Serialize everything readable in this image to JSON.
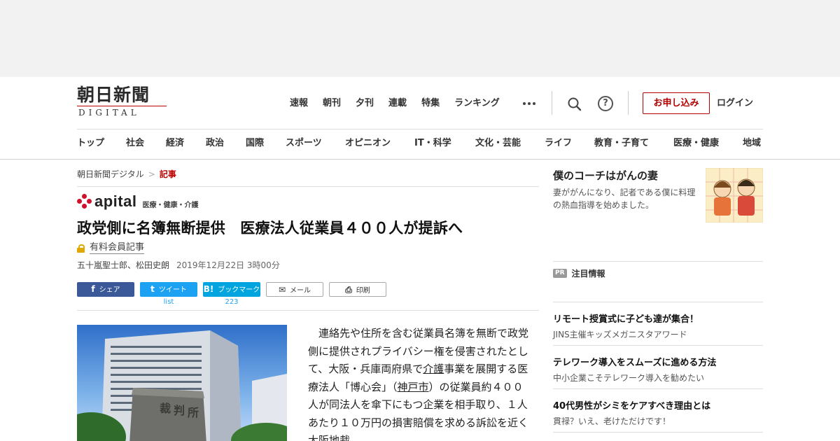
{
  "brand": {
    "logo_main": "朝日新聞",
    "logo_sub": "DIGITAL"
  },
  "top_nav": [
    "速報",
    "朝刊",
    "夕刊",
    "連載",
    "特集",
    "ランキング"
  ],
  "header_actions": {
    "more_icon": "more-dots-icon",
    "search_icon": "search-icon",
    "help_icon": "help-icon",
    "help_glyph": "?",
    "apply_label": "お申し込み",
    "login_label": "ログイン",
    "accent": "#b30000"
  },
  "category_nav": [
    "トップ",
    "社会",
    "経済",
    "政治",
    "国際",
    "スポーツ",
    "オピニオン",
    "IT・科学",
    "文化・芸能",
    "ライフ",
    "教育・子育て",
    "医療・健康",
    "地域"
  ],
  "breadcrumb": {
    "home": "朝日新聞デジタル",
    "separator": ">",
    "current": "記事"
  },
  "section": {
    "brand": "apital",
    "subtitle": "医療・健康・介護"
  },
  "article": {
    "headline": "政党側に名簿無断提供　医療法人従業員４００人が提訴へ",
    "paid_label": "有料会員記事",
    "authors": "五十嵐聖士郎、松田史朗",
    "date": "2019年12月22日 3時00分",
    "body": {
      "p1": "　連絡先や住所を含む従業員名簿を無断で政党側に提供されプライバシー権を侵害されたとして、大阪・兵庫両府県で",
      "link1": "介護",
      "p2": "事業を展開する医療法人「博心会」（",
      "link2": "神戸市",
      "p3": "）の従業員約４００人が同法人を傘下にもつ企業を相手取り、１人あたり１０万円の損害賠償を求める訴訟を近く大阪地裁"
    }
  },
  "share": {
    "facebook": {
      "glyph": "f",
      "label": "シェア"
    },
    "twitter": {
      "glyph": "t",
      "label": "ツイート",
      "count": "list"
    },
    "hatena": {
      "glyph": "B!",
      "label": "ブックマーク",
      "count": "223"
    },
    "mail": {
      "glyph": "✉",
      "label": "メール"
    },
    "print": {
      "glyph": "⎙",
      "label": "印刷"
    },
    "colors": {
      "facebook": "#3b5998",
      "twitter": "#1da1f2",
      "hatena": "#00a4de"
    }
  },
  "sidebar": {
    "feature": {
      "title": "僕のコーチはがんの妻",
      "description": "妻ががんになり、記者である僕に料理の熱血指導を始めました。"
    },
    "pr": {
      "badge": "PR",
      "heading": "注目情報",
      "items": [
        {
          "title": "リモート授賞式に子ども達が集合！",
          "subtitle": "JINS主催キッズメガニスタアワード"
        },
        {
          "title": "テレワーク導入をスムーズに進める方法",
          "subtitle": "中小企業こそテレワーク導入を勧めたい"
        },
        {
          "title": "40代男性がシミをケアすべき理由とは",
          "subtitle": "貫禄？いえ、老けただけです！"
        }
      ]
    }
  }
}
